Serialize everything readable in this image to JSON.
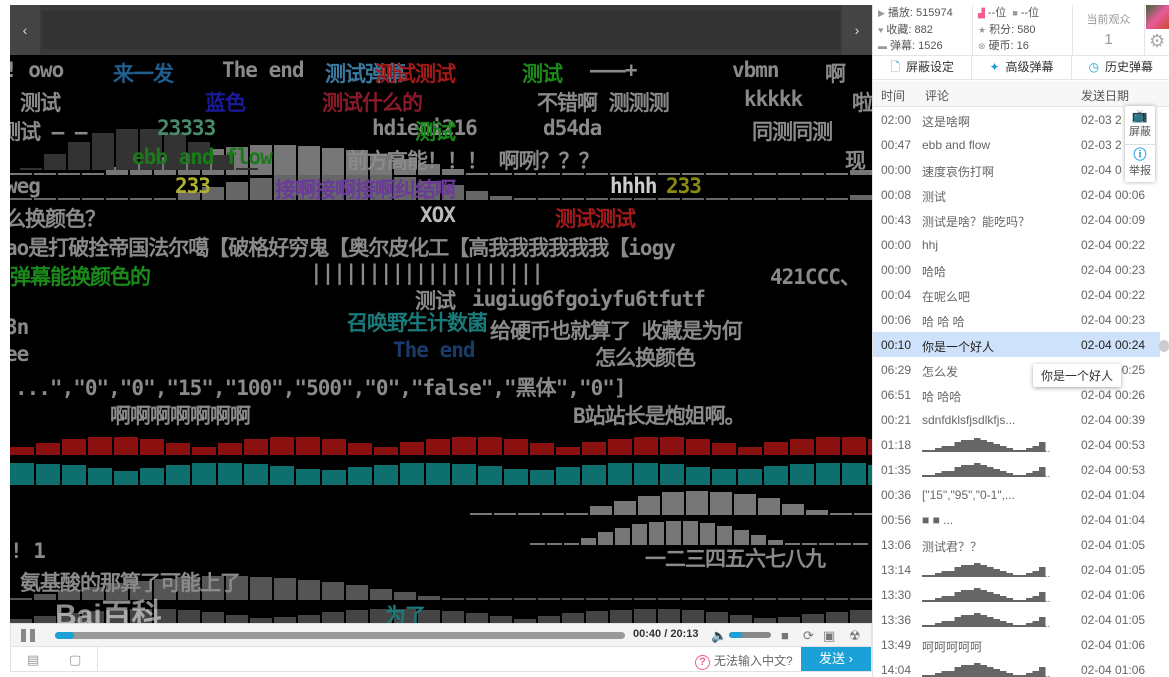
{
  "player": {
    "prev_icon": "chevron-left",
    "next_icon": "chevron-right",
    "danmaku": [
      "! owo",
      "来一发",
      "The end",
      "测试弹幕",
      "测试测试",
      "测试",
      "———+",
      "vbmn",
      "啊",
      "测试",
      "蓝色",
      "测试什么的",
      "不错啊 测测测",
      "kkkkk",
      "啦",
      "测试 — —",
      "23333",
      "hdieoi216",
      "测试",
      "d54da",
      "同测同测",
      "ebb and flow",
      "前方高能！！！ 啊咧？？？",
      "现",
      "weg",
      "233",
      "接啊接啊接啊纠结啊",
      "hhhh",
      "233",
      "么换颜色？",
      "XOX",
      "测试测试",
      "ao是打破拴帝国法尔噶【破格好穷鬼【奥尔皮化工【高我我我我我我【iogy",
      "弹幕能换颜色的",
      "||||||||||||||||||||",
      "421CCC、",
      "测试",
      "iugiug6fgoiyfu6tfutf",
      "3n",
      "召唤野生计数菌",
      "给硬币也就算了 收藏是为何",
      "ee",
      "The end",
      "怎么换颜色",
      "...\",\"0\",\"0\",\"15\",\"100\",\"500\",\"0\",\"false\",\"黑体\",\"0\"]",
      "啊啊啊啊啊啊啊",
      "B站站长是炮姐啊。",
      "! 1",
      "一二三四五六七八九",
      "氨基酸的那算了可能上了",
      "为了"
    ],
    "watermark": "Bai百科",
    "controls": {
      "current_time": "00:40",
      "total_time": "20:13",
      "time_sep": "/",
      "progress_percent": 3.3,
      "volume_percent": 30
    },
    "input": {
      "placeholder": "",
      "help_text": "无法输入中文?",
      "send_label": "发送 ›"
    }
  },
  "panel": {
    "stats": {
      "plays": "播放: 515974",
      "favorites": "收藏: 882",
      "danmaku": "弹幕: 1526",
      "rank1": "--位",
      "rank2": "--位",
      "points": "积分: 580",
      "coins": "硬币: 16"
    },
    "viewers": {
      "label": "当前观众",
      "count": "1"
    },
    "tabs": [
      "屏蔽设定",
      "高级弹幕",
      "历史弹幕"
    ],
    "list_headers": {
      "time": "时间",
      "comment": "评论",
      "date": "发送日期"
    },
    "rows": [
      {
        "time": "02:00",
        "comment": "这是啥啊",
        "date": "02-03 2"
      },
      {
        "time": "00:47",
        "comment": "ebb and flow",
        "date": "02-03 2"
      },
      {
        "time": "00:00",
        "comment": "速度哀伤打啊",
        "date": "02-04 0"
      },
      {
        "time": "00:08",
        "comment": "测试",
        "date": "02-04 00:06"
      },
      {
        "time": "00:43",
        "comment": "测试是啥？能吃吗？",
        "date": "02-04 00:09"
      },
      {
        "time": "00:00",
        "comment": "hhj",
        "date": "02-04 00:22"
      },
      {
        "time": "00:00",
        "comment": "哈哈",
        "date": "02-04 00:23"
      },
      {
        "time": "00:04",
        "comment": "在呢么吧",
        "date": "02-04 00:22"
      },
      {
        "time": "00:06",
        "comment": "哈 哈 哈",
        "date": "02-04 00:23"
      },
      {
        "time": "00:10",
        "comment": "你是一个好人",
        "date": "02-04 00:24",
        "selected": true
      },
      {
        "time": "06:29",
        "comment": "怎么发",
        "date": "02-04 00:25"
      },
      {
        "time": "06:51",
        "comment": "哈  哈哈",
        "date": "02-04 00:26"
      },
      {
        "time": "00:21",
        "comment": "sdnfdklsfjsdlkfjs...",
        "date": "02-04 00:39"
      },
      {
        "time": "01:18",
        "comment": "",
        "spark": true,
        "date": "02-04 00:53"
      },
      {
        "time": "01:35",
        "comment": "",
        "spark": true,
        "date": "02-04 00:53"
      },
      {
        "time": "00:36",
        "comment": "[\"15\",\"95\",\"0-1\",...",
        "date": "02-04 01:04"
      },
      {
        "time": "00:56",
        "comment": "■              ■ ...",
        "date": "02-04 01:04"
      },
      {
        "time": "13:06",
        "comment": "测试君？？",
        "date": "02-04 01:05"
      },
      {
        "time": "13:14",
        "comment": "",
        "spark": true,
        "date": "02-04 01:05"
      },
      {
        "time": "13:30",
        "comment": "",
        "spark": true,
        "date": "02-04 01:06"
      },
      {
        "time": "13:36",
        "comment": "",
        "spark": true,
        "date": "02-04 01:05"
      },
      {
        "time": "13:49",
        "comment": "呵呵呵呵呵",
        "date": "02-04 01:06"
      },
      {
        "time": "14:04",
        "comment": "",
        "spark": true,
        "date": "02-04 01:06"
      }
    ],
    "side_tools": {
      "block": "屏蔽",
      "report": "举报"
    },
    "tooltip": "你是一个好人"
  },
  "colors": {
    "accent": "#1ba1d8",
    "selected_row": "#cfe2fb",
    "help": "#f25d8e"
  }
}
